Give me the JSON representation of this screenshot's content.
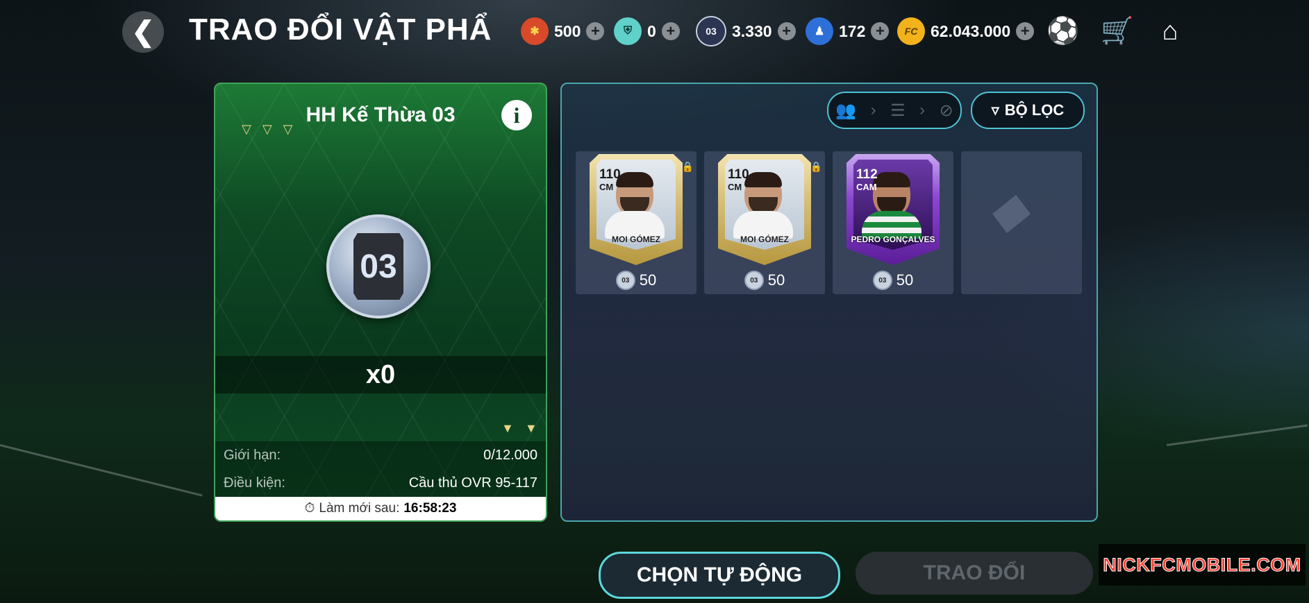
{
  "header": {
    "back_icon": "chevron-left-icon",
    "title": "TRAO ĐỔI VẬT PHẨ",
    "currencies": [
      {
        "name": "event-token",
        "value": "500",
        "color": "#d84a2a"
      },
      {
        "name": "shield-token",
        "value": "0",
        "color": "#5fd1c9"
      },
      {
        "name": "inheritance-token",
        "value": "3.330",
        "color": "#2c3552"
      },
      {
        "name": "player-token",
        "value": "172",
        "color": "#2e6fd8"
      },
      {
        "name": "fc-points",
        "value": "62.043.000",
        "color": "#f2b21b"
      }
    ],
    "icons": [
      "ball-icon",
      "cart-icon",
      "home-icon"
    ]
  },
  "exchange_item": {
    "title": "HH Kế Thừa 03",
    "token_label": "03",
    "quantity": "x0",
    "limit_label": "Giới hạn:",
    "limit_value": "0/12.000",
    "condition_label": "Điều kiện:",
    "condition_value": "Cầu thủ OVR 95-117",
    "refresh_label": "Làm mới sau:",
    "refresh_time": "16:58:23"
  },
  "card_panel": {
    "filter_label": "BỘ LỌC",
    "cards": [
      {
        "ovr": "110",
        "position": "CM",
        "name": "MOI GÓMEZ",
        "cost": "50",
        "token": "03",
        "style": "gold",
        "locked": true
      },
      {
        "ovr": "110",
        "position": "CM",
        "name": "MOI GÓMEZ",
        "cost": "50",
        "token": "03",
        "style": "gold",
        "locked": true
      },
      {
        "ovr": "112",
        "position": "CAM",
        "name": "PEDRO GONÇALVES",
        "cost": "50",
        "token": "03",
        "style": "purple",
        "locked": false
      }
    ]
  },
  "actions": {
    "auto_select": "CHỌN TỰ ĐỘNG",
    "trade": "TRAO ĐỔI"
  },
  "watermark": "NICKFCMOBILE.COM"
}
